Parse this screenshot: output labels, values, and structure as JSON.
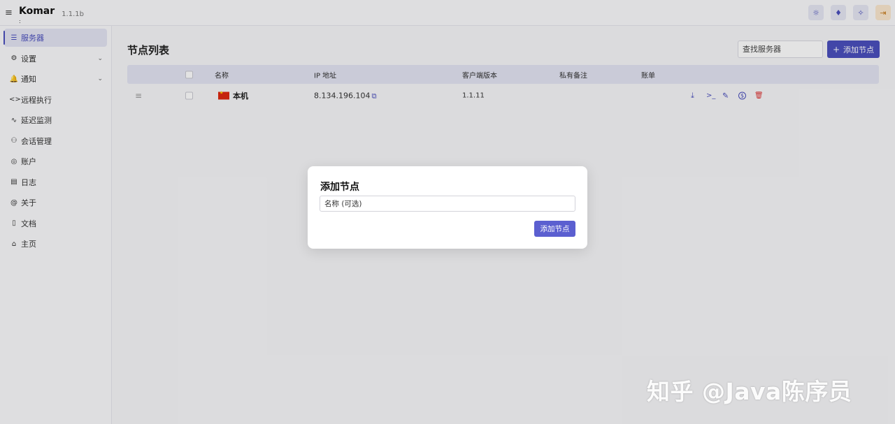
{
  "app": {
    "menu_icon": "hamburger-icon",
    "name": "Komar",
    "version": "1.1.1b"
  },
  "top_actions": [
    {
      "icon": "sun-icon",
      "glyph": "☼"
    },
    {
      "icon": "drop-icon",
      "glyph": "♦"
    },
    {
      "icon": "wand-icon",
      "glyph": "✧"
    },
    {
      "icon": "logout-icon",
      "glyph": "⇥"
    }
  ],
  "sidebar": {
    "items": [
      {
        "label": "服务器",
        "icon": "server-icon",
        "glyph": "☰",
        "active": true
      },
      {
        "label": "设置",
        "icon": "settings-icon",
        "glyph": "⚙",
        "chevron": "⌄"
      },
      {
        "label": "通知",
        "icon": "bell-icon",
        "glyph": "🔔",
        "chevron": "⌄"
      },
      {
        "label": "远程执行",
        "icon": "code-icon",
        "glyph": "<>"
      },
      {
        "label": "延迟监测",
        "icon": "activity-icon",
        "glyph": "∿"
      },
      {
        "label": "会话管理",
        "icon": "users-icon",
        "glyph": "⚇"
      },
      {
        "label": "账户",
        "icon": "account-icon",
        "glyph": "◎"
      },
      {
        "label": "日志",
        "icon": "log-icon",
        "glyph": "▤"
      },
      {
        "label": "关于",
        "icon": "about-icon",
        "glyph": "@"
      },
      {
        "label": "文档",
        "icon": "docs-icon",
        "glyph": "▯"
      },
      {
        "label": "主页",
        "icon": "home-icon",
        "glyph": "⌂"
      }
    ]
  },
  "main": {
    "title": "节点列表",
    "search": {
      "placeholder": "查找服务器",
      "value": ""
    },
    "add_button": {
      "plus": "+",
      "label": "添加节点"
    },
    "table": {
      "columns": [
        "名称",
        "IP 地址",
        "客户端版本",
        "私有备注",
        "账单"
      ],
      "rows": [
        {
          "drag": "≡",
          "flag": "china-flag",
          "name": "本机",
          "ip": "8.134.196.104",
          "copy_icon": "⧉",
          "client_version": "1.1.11",
          "private_note": "",
          "billing": "",
          "actions": [
            {
              "icon": "download-icon",
              "glyph": "⤓"
            },
            {
              "icon": "terminal-icon",
              "glyph": ">_"
            },
            {
              "icon": "edit-icon",
              "glyph": "✎"
            },
            {
              "icon": "dollar-icon",
              "glyph": "$"
            },
            {
              "icon": "trash-icon",
              "glyph": "🗑"
            }
          ]
        }
      ]
    }
  },
  "modal": {
    "title": "添加节点",
    "name_field": {
      "placeholder": "名称 (可选)",
      "value": ""
    },
    "submit_label": "添加节点"
  },
  "watermark": "知乎 @Java陈序员"
}
